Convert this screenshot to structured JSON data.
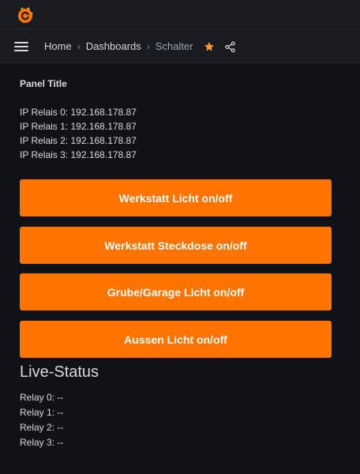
{
  "topbar": {
    "logo_icon": "grafana-logo-icon",
    "logo_color": "#ff7300"
  },
  "navbar": {
    "menu_icon": "hamburger-menu-icon",
    "breadcrumb": {
      "home": "Home",
      "sep1": "›",
      "dashboards": "Dashboards",
      "sep2": "›",
      "current": "Schalter"
    },
    "star_icon": "star-icon",
    "share_icon": "share-icon"
  },
  "panel": {
    "title": "Panel Title",
    "ip_relays": [
      "IP Relais 0: 192.168.178.87",
      "IP Relais 1: 192.168.178.87",
      "IP Relais 2: 192.168.178.87",
      "IP Relais 3: 192.168.178.87"
    ],
    "buttons": [
      "Werkstatt Licht on/off",
      "Werkstatt Steckdose on/off",
      "Grube/Garage Licht on/off",
      "Aussen Licht on/off"
    ],
    "button_color": "#ff7300",
    "live_status_title": "Live-Status",
    "relays": [
      "Relay 0: --",
      "Relay 1: --",
      "Relay 2: --",
      "Relay 3: --"
    ]
  }
}
